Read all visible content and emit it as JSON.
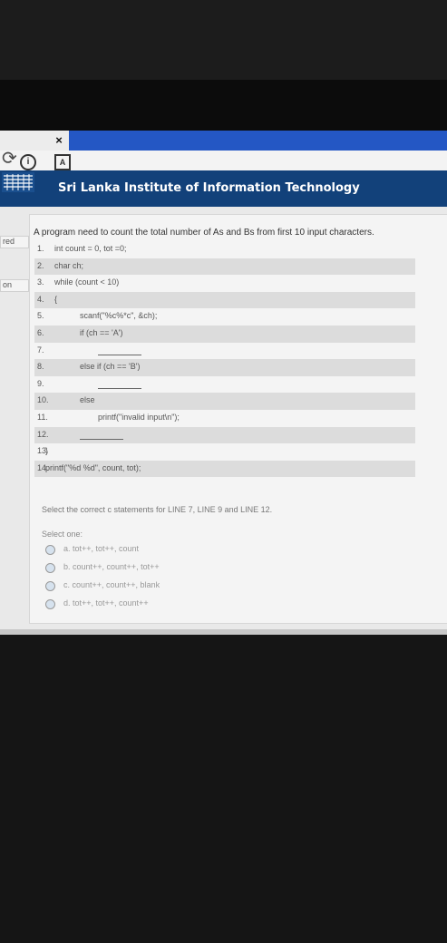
{
  "browser": {
    "tab_close": "×",
    "reload_icon": "reload-icon",
    "info_icon_text": "i",
    "pdf_icon_text": "A"
  },
  "header": {
    "title": "Sri Lanka Institute of Information Technology"
  },
  "sidebar_fragments": [
    "red",
    "on"
  ],
  "quiz": {
    "question": "A program need to count the total number of As and Bs from first 10 input characters.",
    "lines": [
      {
        "num": "1.",
        "code": "int count = 0, tot =0;",
        "indent": 0
      },
      {
        "num": "2.",
        "code": "char ch;",
        "indent": 0
      },
      {
        "num": "3.",
        "code": "while (count < 10)",
        "indent": 0
      },
      {
        "num": "4.",
        "code": "{",
        "indent": 0
      },
      {
        "num": "5.",
        "code": "scanf(\"%c%*c\", &ch);",
        "indent": 1
      },
      {
        "num": "6.",
        "code": "if (ch == 'A')",
        "indent": 1
      },
      {
        "num": "7.",
        "code": "",
        "indent": 2,
        "blank": true
      },
      {
        "num": "8.",
        "code": "else if (ch == 'B')",
        "indent": 1
      },
      {
        "num": "9.",
        "code": "",
        "indent": 2,
        "blank": true
      },
      {
        "num": "10.",
        "code": "else",
        "indent": 1
      },
      {
        "num": "11.",
        "code": "printf(\"invalid input\\n\");",
        "indent": 2
      },
      {
        "num": "12.",
        "code": "",
        "indent": 1,
        "blank": true
      },
      {
        "num": "13.",
        "code": "}",
        "indent": 0
      },
      {
        "num": "14.",
        "code": "printf(\"%d %d\", count, tot);",
        "indent": 0
      }
    ],
    "prompt": "Select the correct c statements for LINE 7, LINE 9 and LINE 12.",
    "select_one": "Select one:",
    "options": [
      "a. tot++, tot++, count",
      "b. count++, count++, tot++",
      "c. count++, count++, blank",
      "d. tot++, tot++, count++"
    ]
  }
}
